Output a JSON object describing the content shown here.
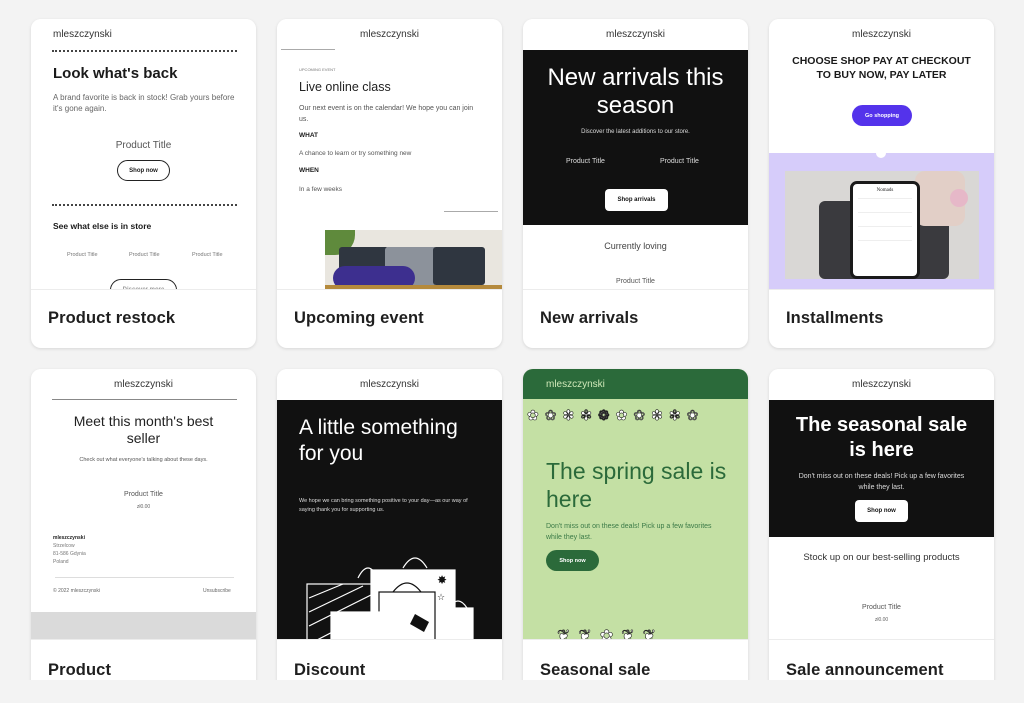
{
  "brand": "mleszczynski",
  "product_title": "Product Title",
  "price": "zł0.00",
  "cards": [
    {
      "label": "Product restock",
      "heading": "Look what's back",
      "body": "A brand favorite is back in stock! Grab yours before it's gone again.",
      "button": "Shop now",
      "section_heading": "See what else is in store",
      "small_products": [
        "Product Title",
        "Product Title",
        "Product Title"
      ],
      "bottom_button": "Discover more"
    },
    {
      "label": "Upcoming event",
      "eyebrow": "UPCOMING EVENT",
      "heading": "Live online class",
      "body": "Our next event is on the calendar! We hope you can join us.",
      "what_label": "WHAT",
      "what_text": "A chance to learn or try something new",
      "when_label": "WHEN",
      "when_text": "In a few weeks"
    },
    {
      "label": "New arrivals",
      "heading": "New arrivals this season",
      "body": "Discover the latest additions to our store.",
      "products": [
        "Product Title",
        "Product Title"
      ],
      "button": "Shop arrivals",
      "section_heading": "Currently loving",
      "bottom_product": "Product Title"
    },
    {
      "label": "Installments",
      "heading": "CHOOSE SHOP PAY AT CHECKOUT TO BUY NOW, PAY LATER",
      "button": "Go shopping",
      "phone_brand": "Nomads",
      "accent": "#5433eb",
      "panel_color": "#d6ccfa"
    },
    {
      "label": "Product",
      "heading": "Meet this month's best seller",
      "body": "Check out what everyone's talking about these days.",
      "address": [
        "mleszczynski",
        "Strzelcow",
        "81-586 Gdynia",
        "Poland"
      ],
      "copyright": "© 2022 mleszczynski",
      "unsubscribe": "Unsubscribe"
    },
    {
      "label": "Discount",
      "heading": "A little something for you",
      "body": "We hope we can bring something positive to your day—as our way of saying thank you for supporting us."
    },
    {
      "label": "Seasonal sale announcement",
      "heading": "The spring sale is here",
      "body": "Don't miss out on these deals! Pick up a few favorites while they last.",
      "button": "Shop now",
      "header_color": "#2b6a3a",
      "bg_color": "#c4e0a4"
    },
    {
      "label": "Sale announcement",
      "heading": "The seasonal sale is here",
      "body": "Don't miss out on these deals! Pick up a few favorites while they last.",
      "button": "Shop now",
      "section_heading": "Stock up on our best-selling products"
    }
  ]
}
